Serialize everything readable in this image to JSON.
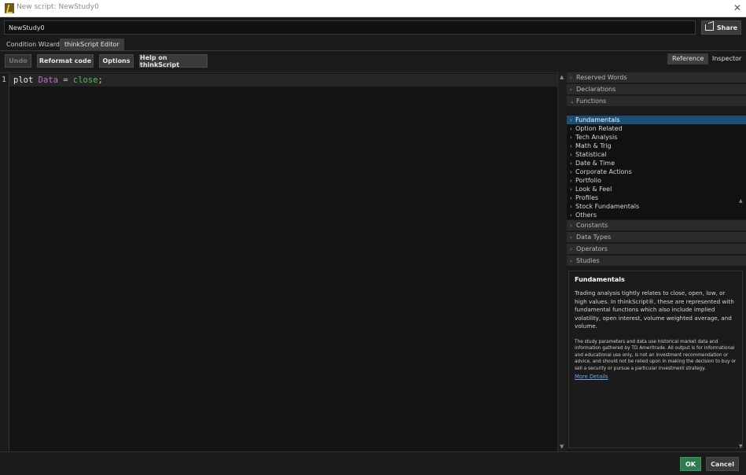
{
  "window": {
    "title": "New script: NewStudy0",
    "close_glyph": "✕"
  },
  "script_name": {
    "value": "NewStudy0"
  },
  "share_label": "Share",
  "tabs": [
    {
      "label": "Condition Wizard"
    },
    {
      "label": "thinkScript Editor"
    }
  ],
  "toolbar": {
    "undo": "Undo",
    "reformat": "Reformat code",
    "options": "Options",
    "help": "Help on thinkScript"
  },
  "side_tabs": {
    "reference": "Reference",
    "inspector": "Inspector"
  },
  "editor": {
    "line_number": "1",
    "code": {
      "kw": "plot",
      "var": "Data",
      "op": "=",
      "fn": "close",
      "punc": ";"
    }
  },
  "sections": [
    {
      "label": "Reserved Words",
      "chev": "›"
    },
    {
      "label": "Declarations",
      "chev": "›"
    },
    {
      "label": "Functions",
      "chev": "⌄"
    },
    {
      "label": "Constants",
      "chev": "›"
    },
    {
      "label": "Data Types",
      "chev": "›"
    },
    {
      "label": "Operators",
      "chev": "›"
    },
    {
      "label": "Studies",
      "chev": "›"
    }
  ],
  "functions": [
    {
      "label": "Fundamentals"
    },
    {
      "label": "Option Related"
    },
    {
      "label": "Tech Analysis"
    },
    {
      "label": "Math & Trig"
    },
    {
      "label": "Statistical"
    },
    {
      "label": "Date & Time"
    },
    {
      "label": "Corporate Actions"
    },
    {
      "label": "Portfolio"
    },
    {
      "label": "Look & Feel"
    },
    {
      "label": "Profiles"
    },
    {
      "label": "Stock Fundamentals"
    },
    {
      "label": "Others"
    }
  ],
  "description": {
    "title": "Fundamentals",
    "body": "Trading analysis tightly relates to close, open, low, or high values. In thinkScript®, these are represented with fundamental functions which also include implied volatility, open interest, volume weighted average, and volume.",
    "disclaimer": "The study parameters and data use historical market data and information gathered by TD Ameritrade. All output is for informational and educational use only, is not an investment recommendation or advice, and should not be relied upon in making the decision to buy or sell a security or pursue a particular investment strategy.",
    "link": "More Details"
  },
  "footer": {
    "ok": "OK",
    "cancel": "Cancel"
  },
  "colors": {
    "selected": "#1c4f74",
    "ok": "#2e7d4f"
  }
}
